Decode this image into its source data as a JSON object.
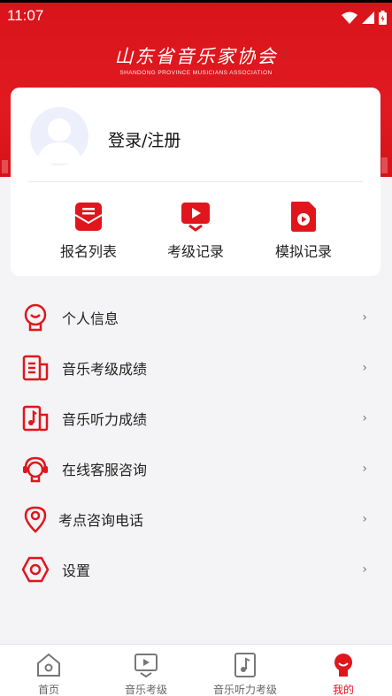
{
  "status_bar": {
    "time": "11:07"
  },
  "header": {
    "logo_cn": "山东省音乐家协会",
    "logo_en": "SHANDONG PROVINCE MUSICIANS ASSOCIATION"
  },
  "profile": {
    "login_label": "登录/注册"
  },
  "quick_actions": [
    {
      "label": "报名列表",
      "icon": "registration-list-icon"
    },
    {
      "label": "考级记录",
      "icon": "exam-record-icon"
    },
    {
      "label": "模拟记录",
      "icon": "mock-record-icon"
    }
  ],
  "menu": [
    {
      "label": "个人信息",
      "icon": "user-info-icon"
    },
    {
      "label": "音乐考级成绩",
      "icon": "music-exam-score-icon"
    },
    {
      "label": "音乐听力成绩",
      "icon": "listening-score-icon"
    },
    {
      "label": "在线客服咨询",
      "icon": "customer-service-icon"
    },
    {
      "label": "考点咨询电话",
      "icon": "location-phone-icon"
    },
    {
      "label": "设置",
      "icon": "settings-icon"
    }
  ],
  "menu_arrow": "›",
  "tabbar": [
    {
      "label": "首页",
      "icon": "home-icon",
      "active": false
    },
    {
      "label": "音乐考级",
      "icon": "music-exam-icon",
      "active": false
    },
    {
      "label": "音乐听力考级",
      "icon": "listening-exam-icon",
      "active": false
    },
    {
      "label": "我的",
      "icon": "profile-icon",
      "active": true
    }
  ],
  "colors": {
    "brand_red": "#e0161c",
    "text": "#222222",
    "tab_inactive": "#666666"
  }
}
